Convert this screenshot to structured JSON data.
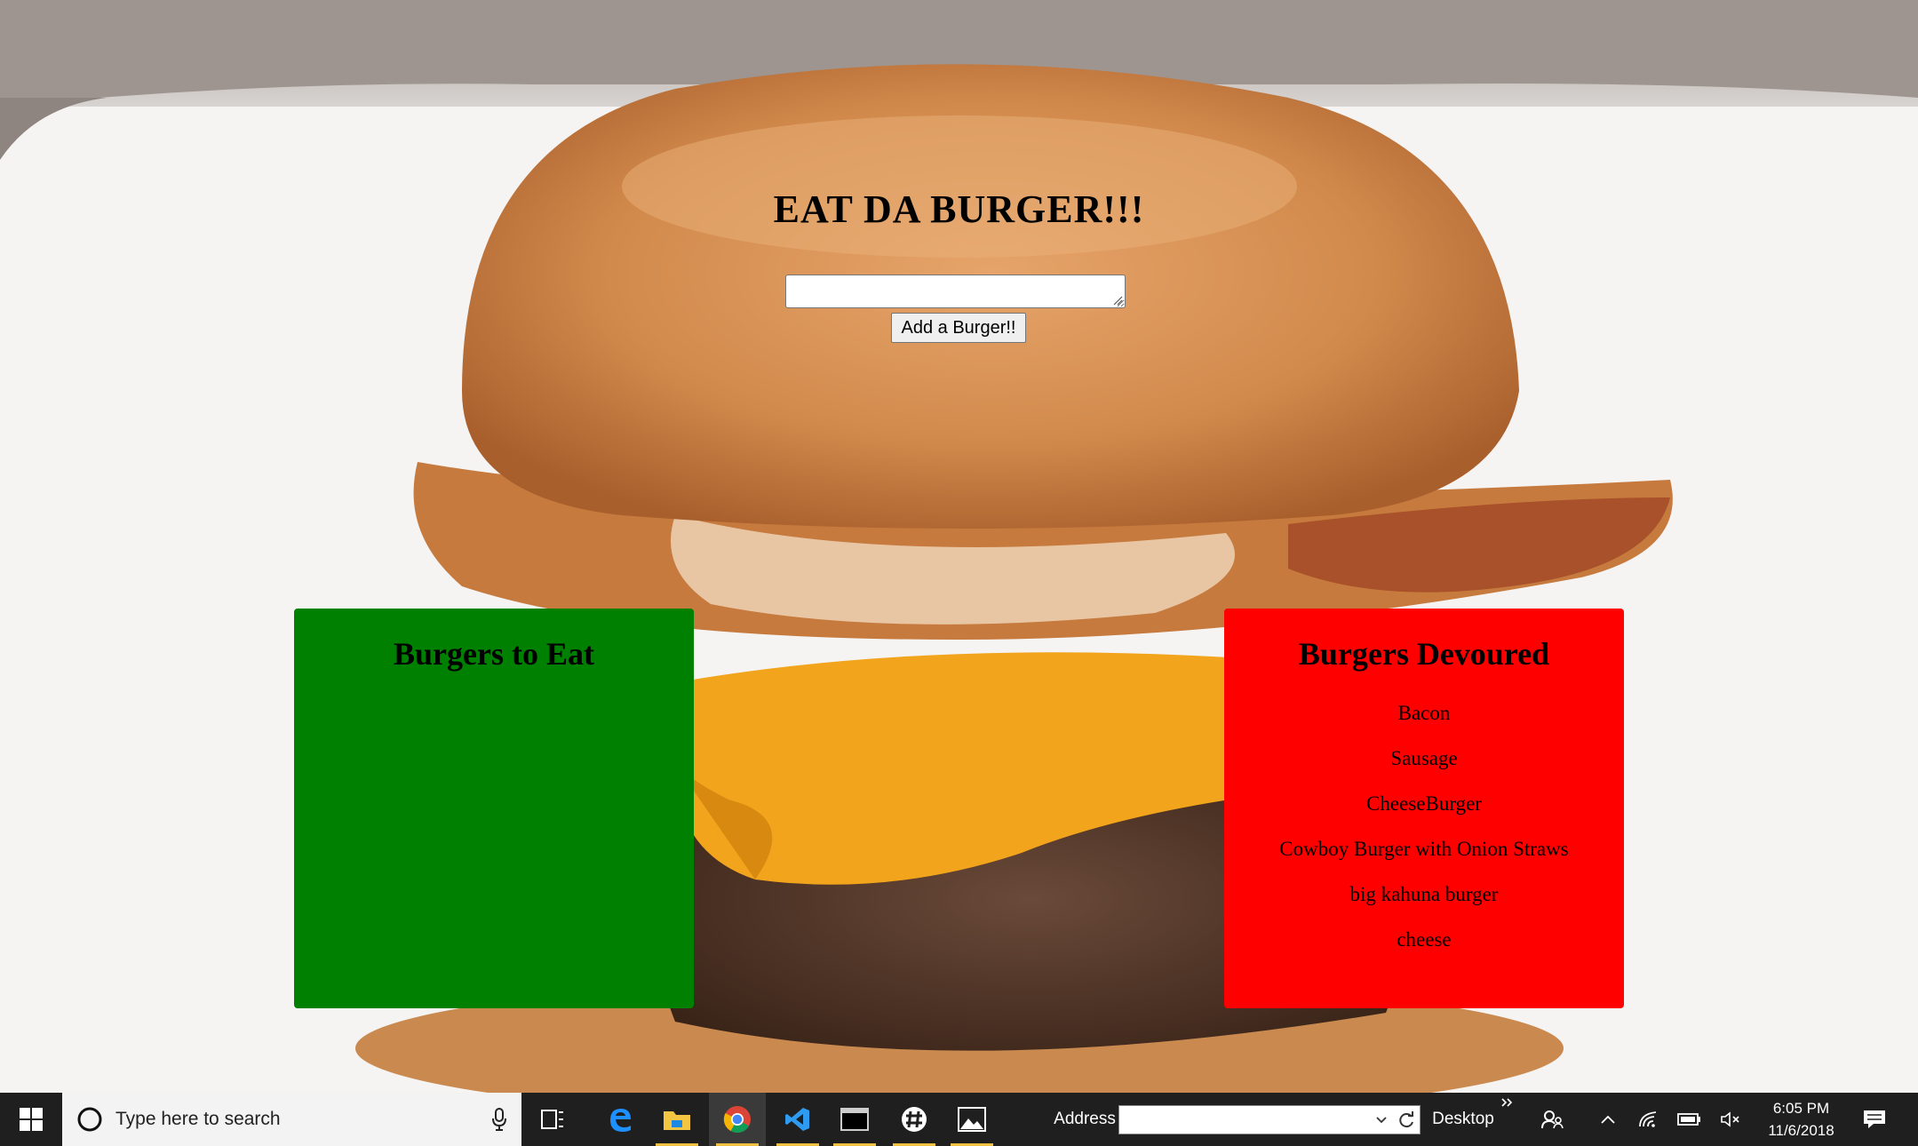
{
  "page": {
    "title": "EAT DA BURGER!!!",
    "input_value": "",
    "add_button_label": "Add a Burger!!"
  },
  "panels": {
    "to_eat": {
      "heading": "Burgers to Eat",
      "items": [],
      "color": "#008000"
    },
    "devoured": {
      "heading": "Burgers Devoured",
      "items": [
        "Bacon",
        "Sausage",
        "CheeseBurger",
        "Cowboy Burger with Onion Straws",
        "big kahuna burger",
        "cheese"
      ],
      "color": "#ff0000"
    }
  },
  "taskbar": {
    "search_placeholder": "Type here to search",
    "address_label": "Address",
    "address_value": "",
    "desktop_label": "Desktop",
    "time": "6:05 PM",
    "date": "11/6/2018",
    "apps": [
      "task-view-icon",
      "edge-icon",
      "file-explorer-icon",
      "chrome-icon",
      "vscode-icon",
      "terminal-icon",
      "slack-icon",
      "photos-icon"
    ],
    "active_app": "chrome-icon"
  }
}
